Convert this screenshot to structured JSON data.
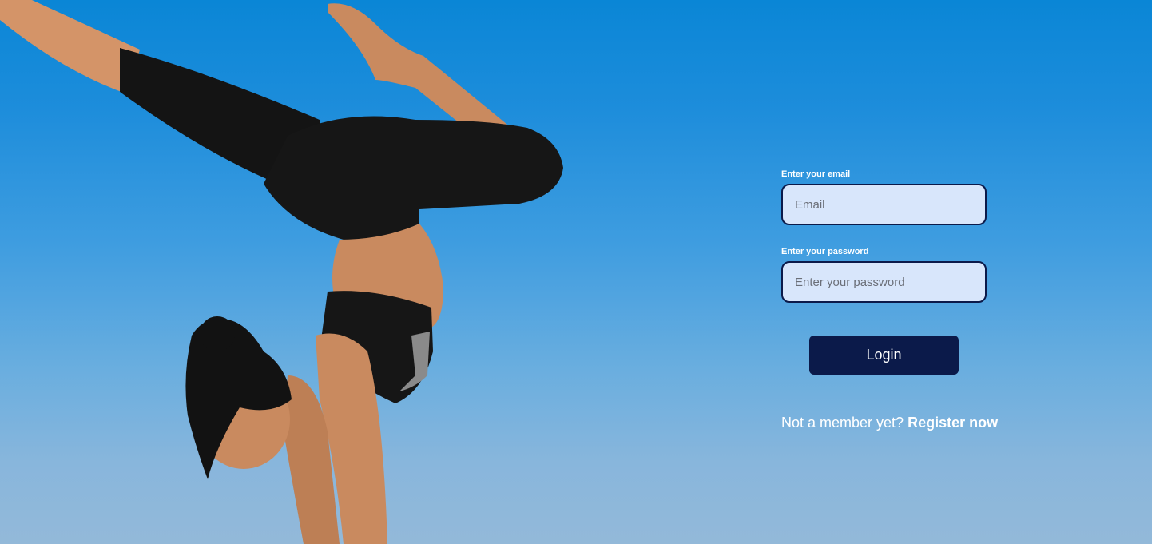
{
  "login_form": {
    "email_label": "Enter your email",
    "email_placeholder": "Email",
    "email_value": "",
    "password_label": "Enter your password",
    "password_placeholder": "Enter your password",
    "password_value": "",
    "login_button_label": "Login",
    "register_prompt": "Not a member yet?",
    "register_link_label": "Register now"
  },
  "colors": {
    "background_top": "#0a86d6",
    "background_bottom": "#93b9d9",
    "input_background": "#d8e6fb",
    "accent": "#0b1a4a",
    "text_light": "#ffffff"
  }
}
